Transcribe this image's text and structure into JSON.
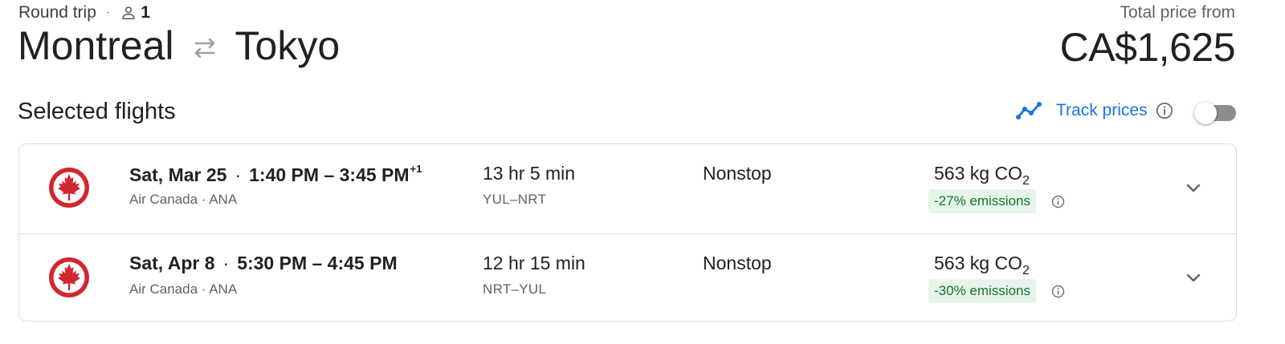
{
  "trip": {
    "type": "Round trip",
    "separator": "·",
    "passengers": "1",
    "origin": "Montreal",
    "destination": "Tokyo"
  },
  "price": {
    "label": "Total price from",
    "value": "CA$1,625"
  },
  "section_title": "Selected flights",
  "track_prices": {
    "label": "Track prices",
    "toggle_on": false
  },
  "flights": [
    {
      "date": "Sat, Mar 25",
      "time_range": "1:40 PM – 3:45 PM",
      "day_offset": "+1",
      "airlines": "Air Canada · ANA",
      "duration": "13 hr 5 min",
      "airports": "YUL–NRT",
      "stops": "Nonstop",
      "co2_value": "563 kg CO",
      "co2_sub": "2",
      "emissions": "-27% emissions"
    },
    {
      "date": "Sat, Apr 8",
      "time_range": "5:30 PM – 4:45 PM",
      "day_offset": "",
      "airlines": "Air Canada · ANA",
      "duration": "12 hr 15 min",
      "airports": "NRT–YUL",
      "stops": "Nonstop",
      "co2_value": "563 kg CO",
      "co2_sub": "2",
      "emissions": "-30% emissions"
    }
  ],
  "colors": {
    "accent": "#1a73e8",
    "air_canada_red": "#d22630",
    "emissions_bg": "#e6f4ea",
    "emissions_text": "#137333"
  },
  "icons": {
    "person": "person-icon",
    "swap": "swap-arrows-icon",
    "trend": "trending-line-icon",
    "info": "info-icon",
    "chevron": "chevron-down-icon",
    "airline_logo": "air-canada-maple-leaf-logo"
  }
}
